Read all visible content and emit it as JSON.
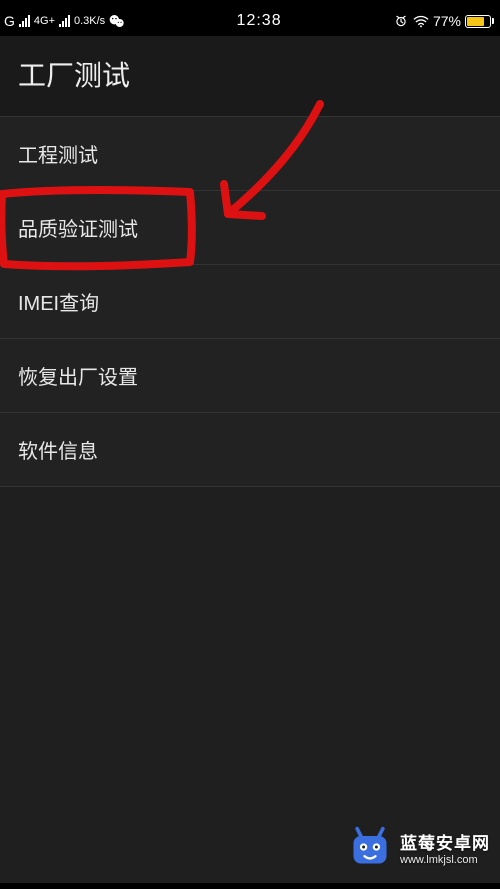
{
  "status_bar": {
    "carrier_prefix": "G",
    "net_type": "4G+",
    "speed": "0.3K/s",
    "time": "12:38",
    "battery_percent_text": "77%",
    "battery_percent": 77
  },
  "header": {
    "title": "工厂测试"
  },
  "menu": {
    "items": [
      {
        "label": "工程测试"
      },
      {
        "label": "品质验证测试"
      },
      {
        "label": "IMEI查询"
      },
      {
        "label": "恢复出厂设置"
      },
      {
        "label": "软件信息"
      }
    ],
    "highlighted_index": 1
  },
  "annotation": {
    "type": "red-box-and-arrow",
    "target_label": "品质验证测试",
    "color": "#d11a1a"
  },
  "watermark": {
    "title": "蓝莓安卓网",
    "url": "www.lmkjsl.com"
  }
}
